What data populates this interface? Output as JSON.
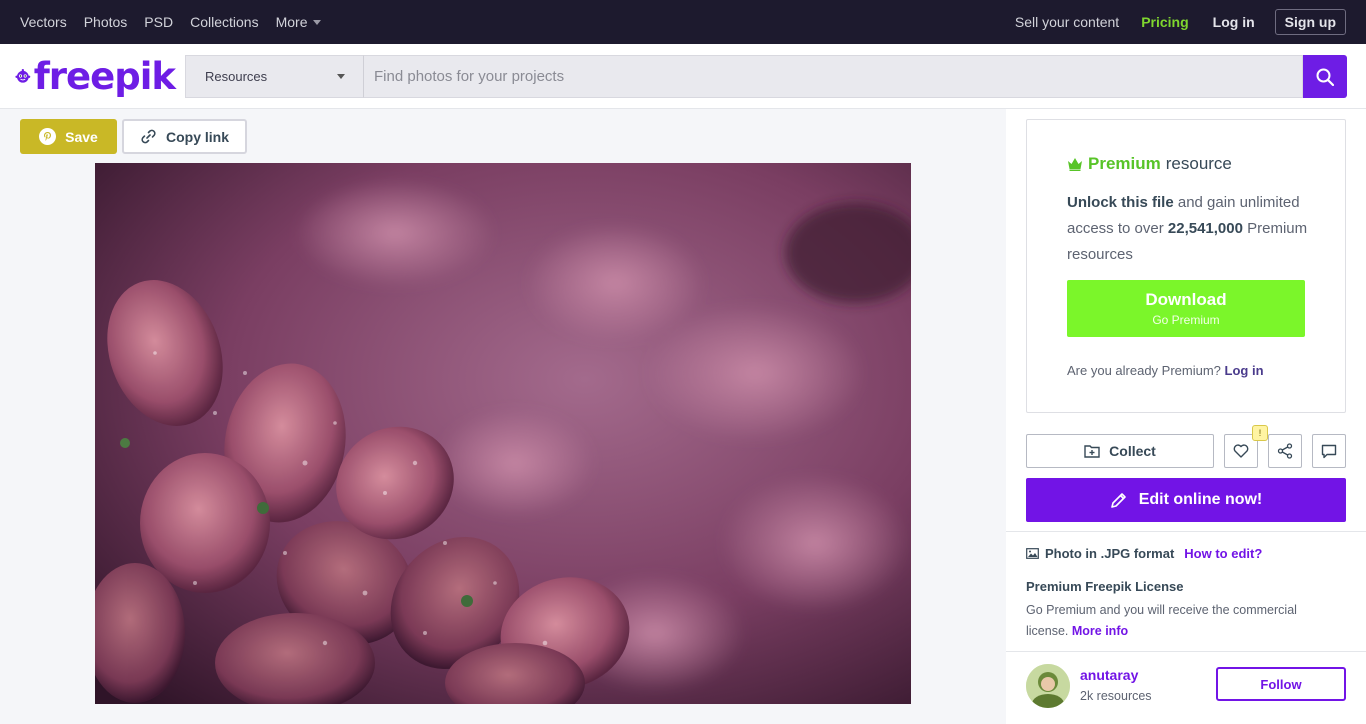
{
  "topnav": {
    "links": [
      "Vectors",
      "Photos",
      "PSD",
      "Collections",
      "More"
    ],
    "sell": "Sell your content",
    "pricing": "Pricing",
    "login": "Log in",
    "signup": "Sign up"
  },
  "header": {
    "logo_text": "freepik",
    "search_type": "Resources",
    "search_placeholder": "Find photos for your projects",
    "brand_color": "#6e1de5"
  },
  "toolbar": {
    "save_label": "Save",
    "copy_label": "Copy link"
  },
  "premium": {
    "premium_word": "Premium",
    "resource_word": "resource",
    "unlock_bold": "Unlock this file",
    "unlock_rest": "and gain unlimited access to over",
    "count": "22,541,000",
    "count_suffix": "Premium resources",
    "download_label": "Download",
    "download_sub": "Go Premium",
    "already_text": "Are you already Premium?",
    "already_link": "Log in"
  },
  "actions": {
    "collect_label": "Collect",
    "badge": "!",
    "edit_label": "Edit online now!"
  },
  "info": {
    "format": "Photo in .JPG format",
    "how_to_edit": "How to edit?",
    "license_title": "Premium Freepik License",
    "license_text": "Go Premium and you will receive the commercial license.",
    "more_info": "More info"
  },
  "author": {
    "name": "anutaray",
    "resources": "2k resources",
    "follow_label": "Follow"
  }
}
